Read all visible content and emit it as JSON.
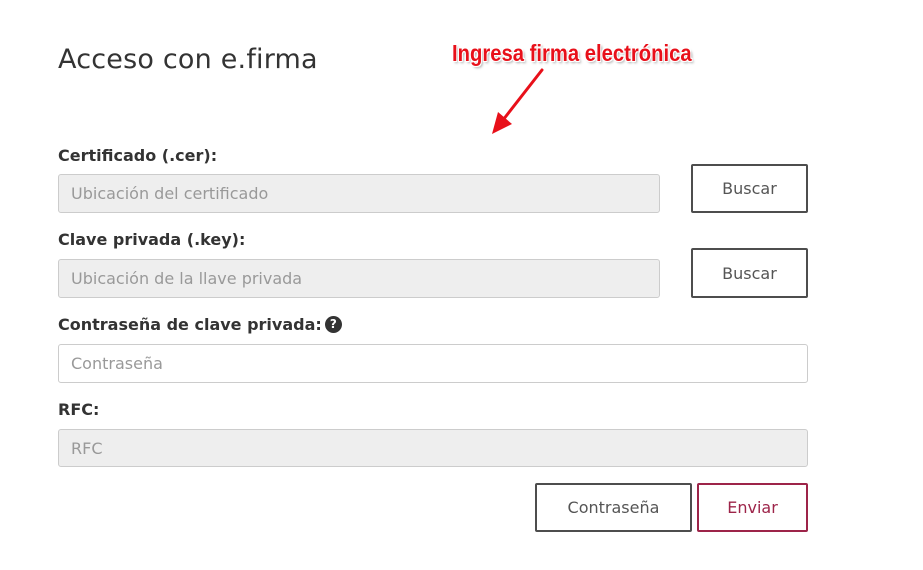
{
  "page": {
    "title": "Acceso con e.firma"
  },
  "annotation": {
    "text": "Ingresa firma electrónica",
    "color": "#e8101a"
  },
  "form": {
    "certificate": {
      "label": "Certificado (.cer):",
      "placeholder": "Ubicación del certificado",
      "button_label": "Buscar"
    },
    "private_key": {
      "label": "Clave privada (.key):",
      "placeholder": "Ubicación de la llave privada",
      "button_label": "Buscar"
    },
    "password": {
      "label": "Contraseña de clave privada:",
      "placeholder": "Contraseña",
      "help_icon": "question-circle-icon"
    },
    "rfc": {
      "label": "RFC:",
      "placeholder": "RFC"
    }
  },
  "actions": {
    "password_label": "Contraseña",
    "submit_label": "Enviar"
  },
  "colors": {
    "primary": "#9d2449",
    "disabled_input_bg": "#eeeeee",
    "button_border": "#4d4d4d"
  }
}
